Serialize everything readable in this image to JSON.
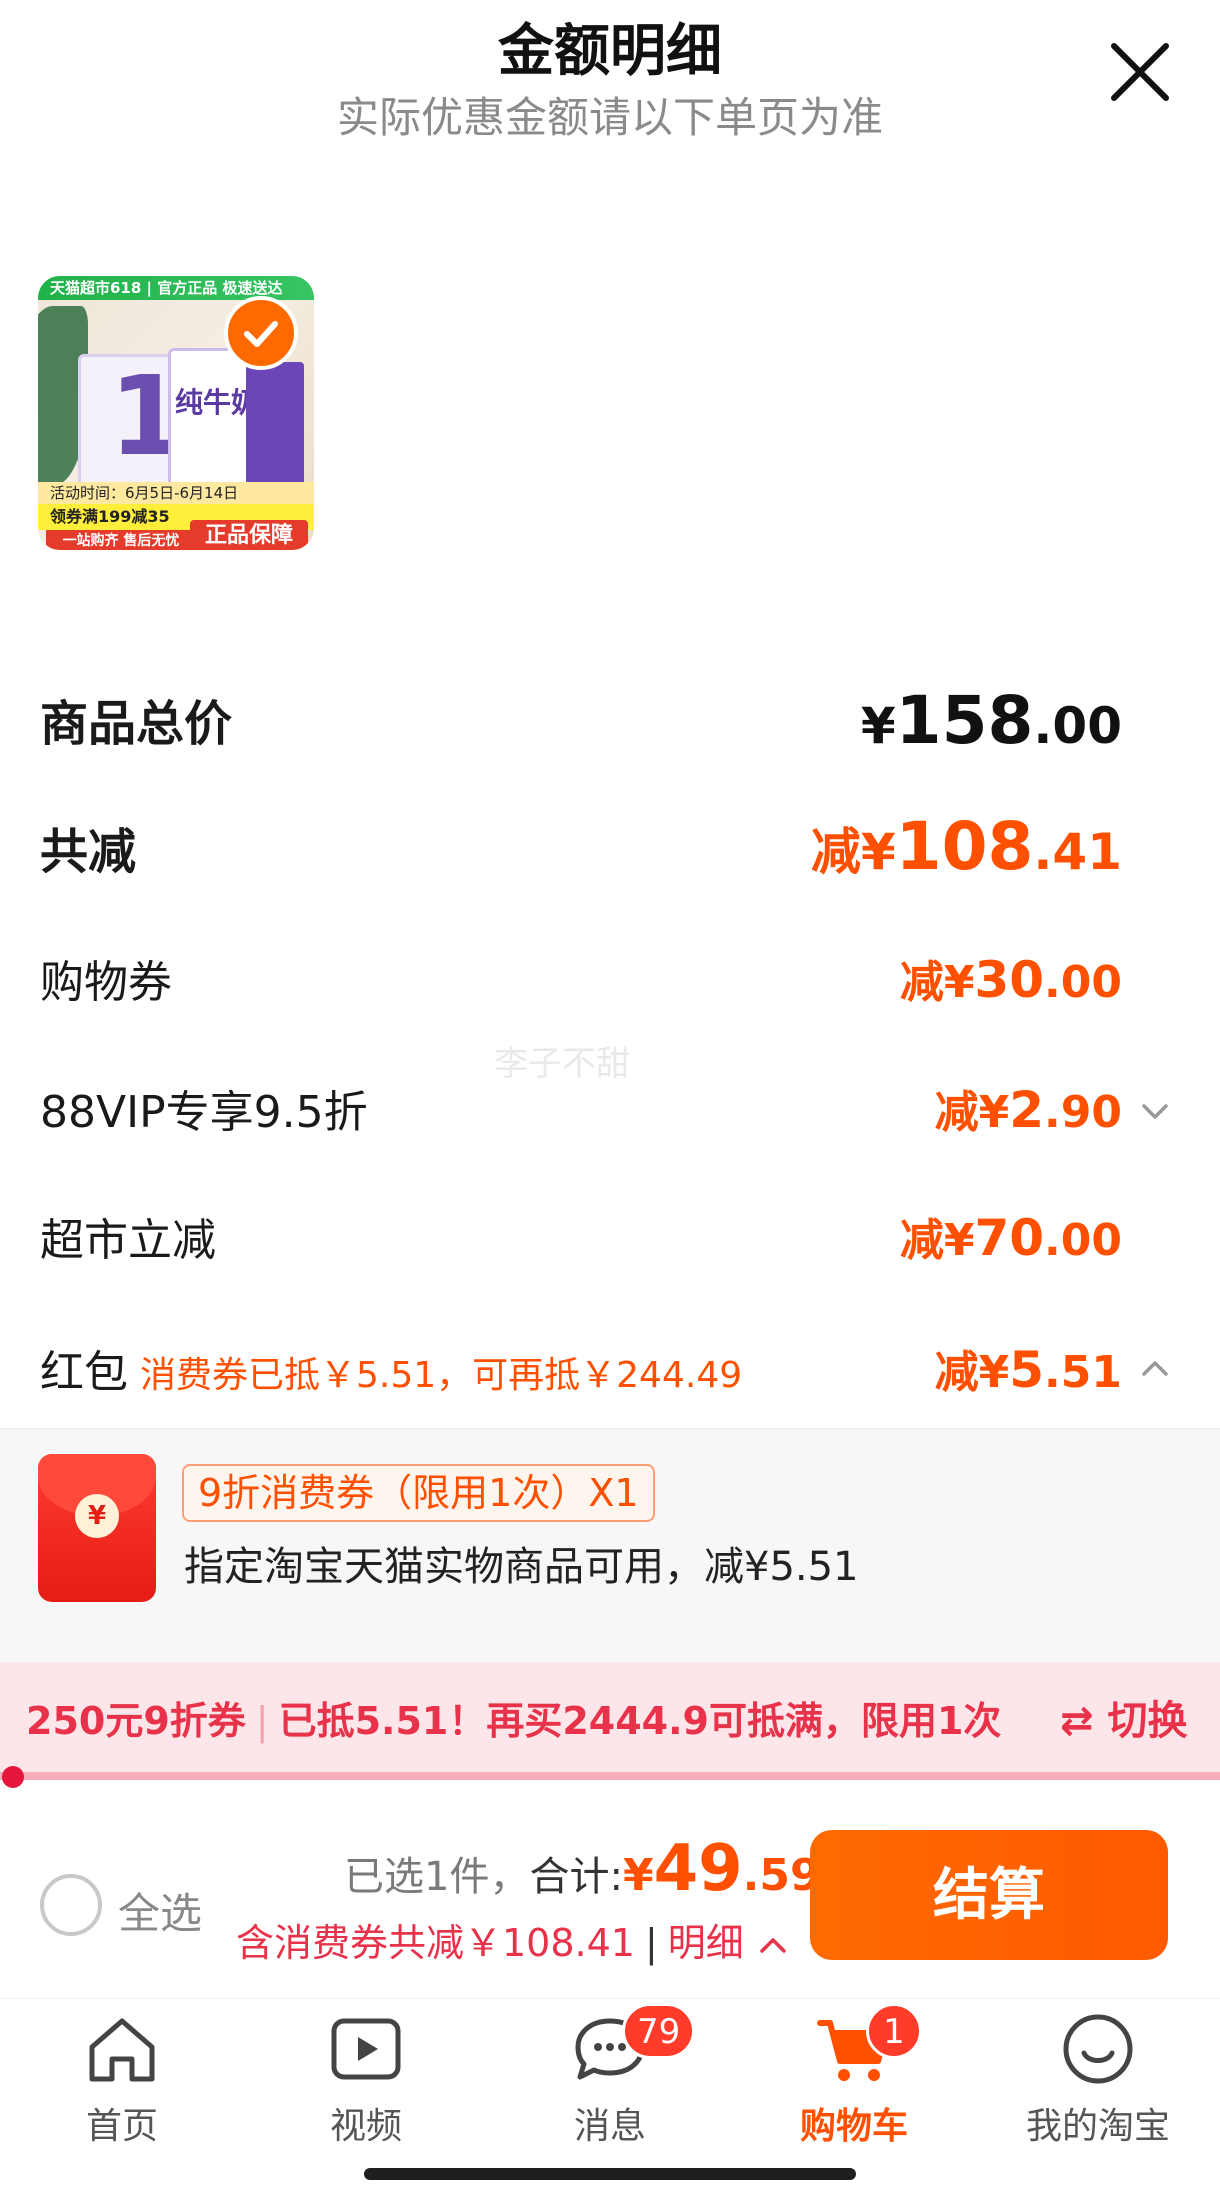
{
  "header": {
    "title": "金额明细",
    "subtitle": "实际优惠金额请以下单页为准"
  },
  "product": {
    "badge_text": "天猫超市618 | 官方正品 极速送达",
    "product_label": "纯牛奶",
    "promo_line1": "活动时间：6月5日-6月14日",
    "promo_line2": "领券满199减35",
    "tag_left": "一站购齐 售后无忧",
    "tag_right": "正品保障",
    "selected": true
  },
  "breakdown": {
    "total": {
      "label": "商品总价",
      "currency": "¥",
      "int": "158",
      "dec": ".00"
    },
    "reduced": {
      "label": "共减",
      "prefix": "减",
      "currency": "¥",
      "int": "108",
      "dec": ".41"
    },
    "coupon": {
      "label": "购物券",
      "prefix": "减",
      "currency": "¥",
      "int": "30",
      "dec": ".00"
    },
    "vip": {
      "label": "88VIP专享9.5折",
      "prefix": "减",
      "currency": "¥",
      "int": "2",
      "dec": ".90"
    },
    "market": {
      "label": "超市立减",
      "prefix": "减",
      "currency": "¥",
      "int": "70",
      "dec": ".00"
    },
    "redpacket": {
      "label": "红包",
      "note": "消费券已抵￥5.51，可再抵￥244.49",
      "prefix": "减",
      "currency": "¥",
      "int": "5",
      "dec": ".51"
    }
  },
  "coupon_card": {
    "tag": "9折消费券（限用1次）X1",
    "description": "指定淘宝天猫实物商品可用，减¥5.51",
    "coin": "¥"
  },
  "banner": {
    "left": "250元9折券",
    "right": "已抵5.51！再买2444.9可抵满，限用1次",
    "switch_label": "切换",
    "switch_icon": "⇄",
    "progress": 0.0
  },
  "checkout": {
    "select_all": "全选",
    "selected_count": "已选1件，",
    "total_label": "合计:",
    "currency": "¥",
    "price_int": "49",
    "price_dec": ".59",
    "savings_text": "含消费券共减￥108.41",
    "separator": "|",
    "detail_label": "明细",
    "button": "结算"
  },
  "nav": {
    "items": [
      {
        "label": "首页"
      },
      {
        "label": "视频"
      },
      {
        "label": "消息",
        "badge": "79"
      },
      {
        "label": "购物车",
        "badge": "1"
      },
      {
        "label": "我的淘宝"
      }
    ]
  },
  "watermark": "李子不甜",
  "colors": {
    "accent": "#ff5000",
    "banner_pink": "#fde6ea",
    "banner_text": "#e8324a",
    "badge_red": "#ff3b2a"
  }
}
